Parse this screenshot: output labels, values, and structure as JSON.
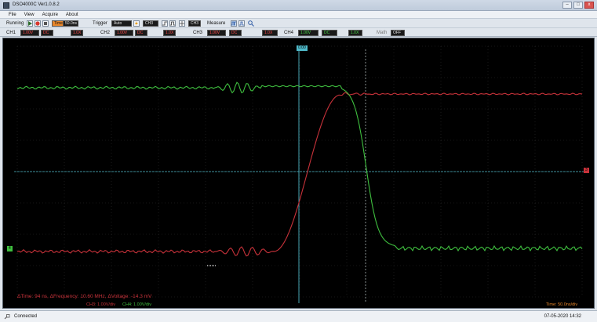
{
  "window": {
    "title": "DSO4000C Ver1.0.8.2",
    "btn_min": "–",
    "btn_max": "□",
    "btn_close": "x"
  },
  "menu": [
    "File",
    "View",
    "Acquire",
    "About"
  ],
  "toolbar": {
    "status": "Running",
    "time_label": "Time",
    "time_value": "50.0ns",
    "trigger_label": "Trigger",
    "trigger_mode": "Auto",
    "trigger_source": "CH3",
    "ch_select": "CH3",
    "measure_label": "Measure"
  },
  "channels": [
    {
      "label": "CH1",
      "volts": "1.00V",
      "coupling": "DC",
      "probe": "1.0X"
    },
    {
      "label": "CH2",
      "volts": "1.00V",
      "coupling": "DC",
      "probe": "1.0X"
    },
    {
      "label": "CH3",
      "volts": "1.00V",
      "coupling": "DC",
      "probe": "1.0X"
    },
    {
      "label": "CH4",
      "volts": "1.00V",
      "coupling": "DC",
      "probe": "1.0X"
    }
  ],
  "math": {
    "label": "Math",
    "value": "OFF"
  },
  "scope": {
    "trigger_marker": "0.00",
    "measure_text": "ΔTime: 94 ns, ΔFrequency: 10.60 MHz, ΔVoltage: -14.3 mV",
    "ch3_scale": "CH3: 1.00V/div",
    "ch4_scale": "CH4: 1.00V/div",
    "timebase": "Time: 50.0ns/div",
    "ch_marker_right": "3",
    "ch_marker_left": "4",
    "colors": {
      "ch3": "#c8323a",
      "ch4": "#3fbf3f",
      "cursor": "#4fb9c9",
      "grid": "#2c2c2c"
    }
  },
  "statusbar": {
    "connection": "Connected",
    "datetime": "07-05-2020  14:32"
  }
}
